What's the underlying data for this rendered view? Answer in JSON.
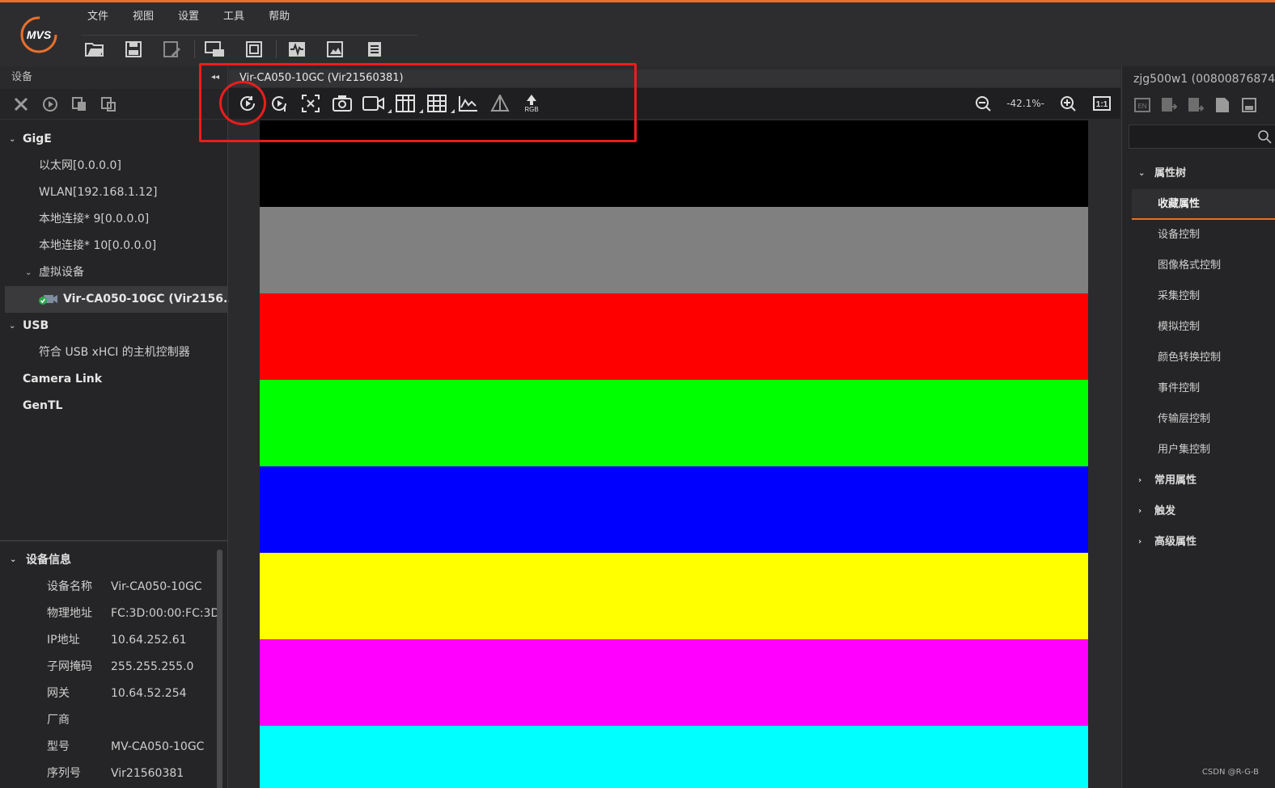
{
  "menu": [
    "文件",
    "视图",
    "设置",
    "工具",
    "帮助"
  ],
  "logo_text": "MVS",
  "toolbar_icons": [
    "open-folder-icon",
    "save-icon",
    "save-as-icon",
    "multi-window-icon",
    "fullscreen-icon",
    "waveform-icon",
    "image-edit-icon",
    "list-icon"
  ],
  "device_panel": {
    "title": "设备",
    "collapse_glyph": "◂◂",
    "tools": [
      "disconnect-icon",
      "play-icon",
      "copy-icon",
      "batch-icon"
    ],
    "tree": {
      "gige": {
        "label": "GigE",
        "items": [
          "以太网[0.0.0.0]",
          "WLAN[192.168.1.12]",
          "本地连接* 9[0.0.0.0]",
          "本地连接* 10[0.0.0.0]"
        ]
      },
      "virtual": {
        "label": "虚拟设备",
        "device": "Vir-CA050-10GC (Vir2156..."
      },
      "usb": {
        "label": "USB",
        "items": [
          "符合 USB xHCI 的主机控制器"
        ]
      },
      "cameralink": "Camera Link",
      "gentl": "GenTL"
    }
  },
  "device_info": {
    "title": "设备信息",
    "rows": [
      {
        "k": "设备名称",
        "v": "Vir-CA050-10GC"
      },
      {
        "k": "物理地址",
        "v": "FC:3D:00:00:FC:3D"
      },
      {
        "k": "IP地址",
        "v": "10.64.252.61"
      },
      {
        "k": "子网掩码",
        "v": "255.255.255.0"
      },
      {
        "k": "网关",
        "v": "10.64.52.254"
      },
      {
        "k": "厂商",
        "v": ""
      },
      {
        "k": "型号",
        "v": "MV-CA050-10GC"
      },
      {
        "k": "序列号",
        "v": "Vir21560381"
      }
    ]
  },
  "viewer": {
    "tab_title": "Vir-CA050-10GC (Vir21560381)",
    "zoom": "-42.1%-",
    "ratio_label": "1:1",
    "rgb_label": "RGB",
    "stripes": [
      "#000000",
      "#808080",
      "#ff0000",
      "#00ff00",
      "#0000ff",
      "#ffff00",
      "#ff00ff",
      "#00ffff"
    ]
  },
  "properties": {
    "device_title": "zjg500w1 (00800876874",
    "tree_title": "属性树",
    "selected": "收藏属性",
    "children": [
      "设备控制",
      "图像格式控制",
      "采集控制",
      "模拟控制",
      "颜色转换控制",
      "事件控制",
      "传输层控制",
      "用户集控制"
    ],
    "groups": [
      "常用属性",
      "触发",
      "高级属性"
    ]
  },
  "watermark": "CSDN @R-G-B",
  "colors": {
    "accent": "#e8702a",
    "highlight": "#ee1c1c"
  }
}
